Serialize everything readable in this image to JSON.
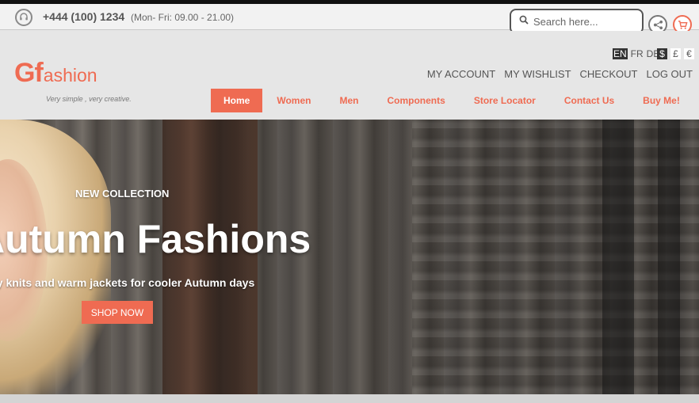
{
  "topbar": {
    "phone": "+444 (100) 1234",
    "hours": "(Mon- Fri: 09.00 - 21.00)",
    "search": {
      "placeholder": "Search here..."
    },
    "icons": [
      "headset-icon",
      "search-icon",
      "share-icon",
      "cart-icon"
    ]
  },
  "header": {
    "logo": {
      "mark": "Gf",
      "word": "ashion"
    },
    "tagline": "Very simple , very creative.",
    "languages": [
      {
        "label": "EN",
        "active": true
      },
      {
        "label": "FR",
        "active": false
      },
      {
        "label": "DE",
        "active": false
      }
    ],
    "currencies": [
      {
        "label": "$",
        "active": true
      },
      {
        "label": "£",
        "active": false
      },
      {
        "label": "€",
        "active": false
      }
    ],
    "account_links": [
      "MY ACCOUNT",
      "MY WISHLIST",
      "CHECKOUT",
      "LOG OUT"
    ],
    "nav": [
      {
        "label": "Home",
        "active": true
      },
      {
        "label": "Women",
        "active": false
      },
      {
        "label": "Men",
        "active": false
      },
      {
        "label": "Components",
        "active": false
      },
      {
        "label": "Store Locator",
        "active": false
      },
      {
        "label": "Contact Us",
        "active": false
      },
      {
        "label": "Buy Me!",
        "active": false
      }
    ]
  },
  "hero": {
    "subtitle": "NEW COLLECTION",
    "title": "Autumn Fashions",
    "description": "Comfy knits and warm jackets for cooler Autumn days",
    "button": "SHOP NOW"
  },
  "colors": {
    "accent": "#ef6b52",
    "topbar_bg": "#f2f2f2",
    "header_bg": "#e6e6e6"
  }
}
